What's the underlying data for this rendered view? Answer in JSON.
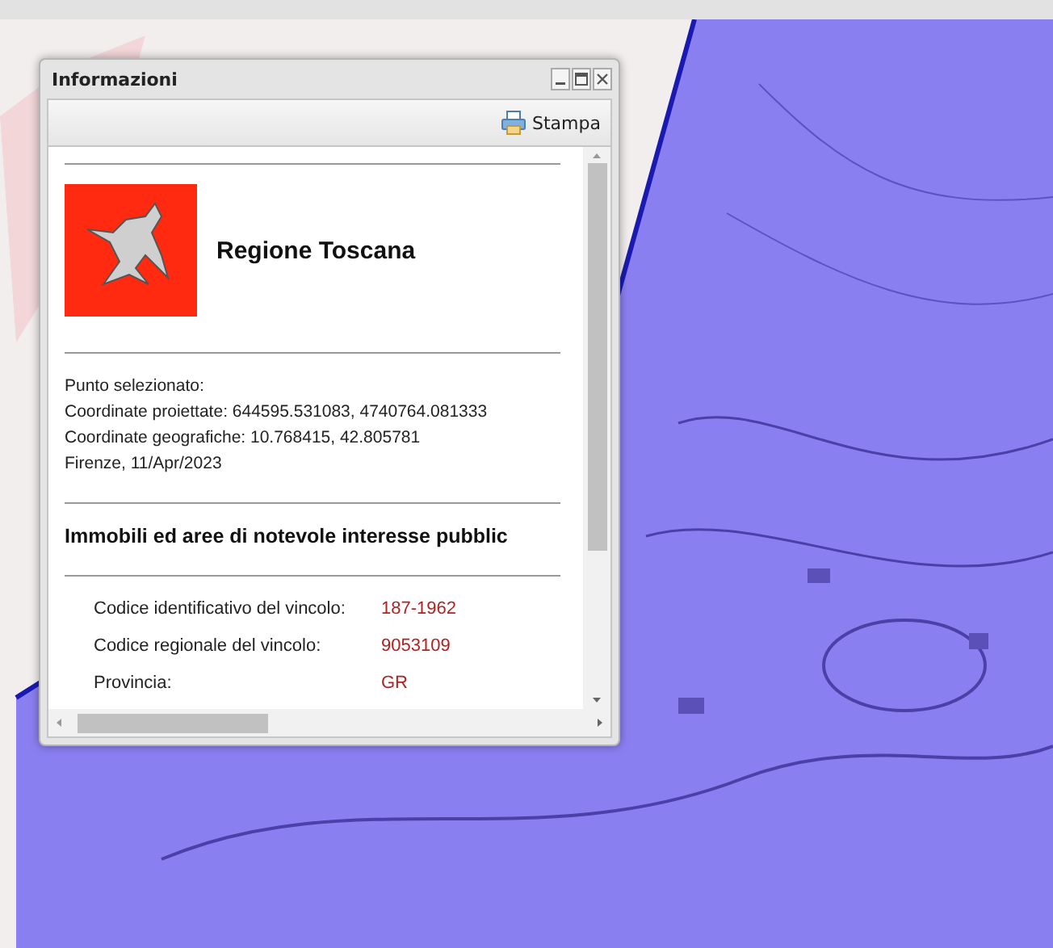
{
  "window": {
    "title": "Informazioni",
    "controls": [
      {
        "kind": "minimize"
      },
      {
        "kind": "maximize"
      },
      {
        "kind": "close"
      }
    ]
  },
  "toolbar": {
    "print_label": "Stampa"
  },
  "header": {
    "organization": "Regione Toscana"
  },
  "point": {
    "lines": [
      "Punto selezionato:",
      "Coordinate proiettate: 644595.531083, 4740764.081333",
      "Coordinate geografiche: 10.768415, 42.805781",
      "Firenze, 11/Apr/2023"
    ]
  },
  "section": {
    "title": "Immobili ed aree di notevole interesse pubblic"
  },
  "fields": [
    {
      "label": "Codice identificativo del vincolo:",
      "value": "187-1962"
    },
    {
      "label": "Codice regionale del vincolo:",
      "value": "9053109"
    },
    {
      "label": "Provincia:",
      "value": "GR"
    }
  ]
}
